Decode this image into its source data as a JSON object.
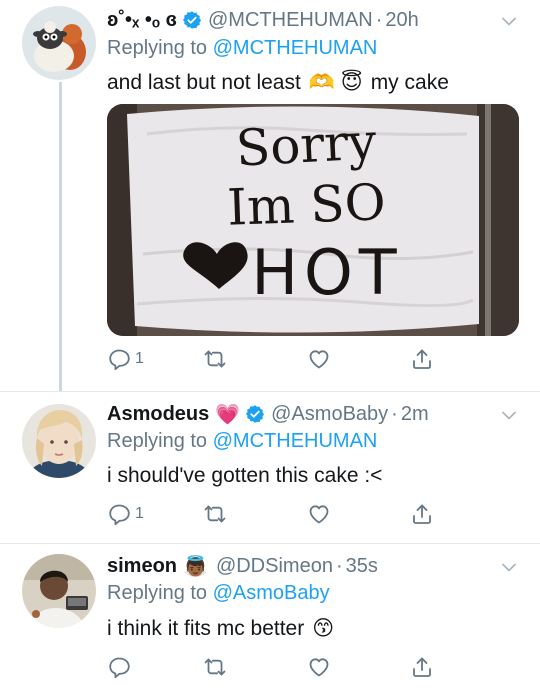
{
  "tweets": [
    {
      "name": "ʚ˚•ₓ •ₒ ɞ",
      "handle": "@MCTHEHUMAN",
      "time": "20h",
      "replying_prefix": "Replying to",
      "replying_to": "@MCTHEHUMAN",
      "text_before": "and last but not least",
      "text_after": "my cake",
      "emoji": "🫶 😇",
      "cake_lines": [
        "Sorry",
        "Im SO",
        "HOT"
      ],
      "reply_count": "1",
      "retweet_count": "",
      "like_count": ""
    },
    {
      "name": "Asmodeus",
      "name_emoji": "💗",
      "handle": "@AsmoBaby",
      "time": "2m",
      "replying_prefix": "Replying to",
      "replying_to": "@MCTHEHUMAN",
      "text": "i should've gotten this cake :<",
      "reply_count": "1",
      "retweet_count": "",
      "like_count": ""
    },
    {
      "name": "simeon",
      "name_emoji": "👼🏾",
      "handle": "@DDSimeon",
      "time": "35s",
      "replying_prefix": "Replying to",
      "replying_to": "@AsmoBaby",
      "text": "i think it fits mc better",
      "text_emoji": "😙",
      "reply_count": "",
      "retweet_count": "",
      "like_count": ""
    }
  ],
  "colors": {
    "accent": "#1da1f2",
    "secondary_text": "#657786",
    "thread_line": "#ccd6dd",
    "divider": "#e1e8ed"
  },
  "icons": [
    "verified-badge-icon",
    "caret-down-icon",
    "reply-icon",
    "retweet-icon",
    "like-icon",
    "share-icon"
  ]
}
